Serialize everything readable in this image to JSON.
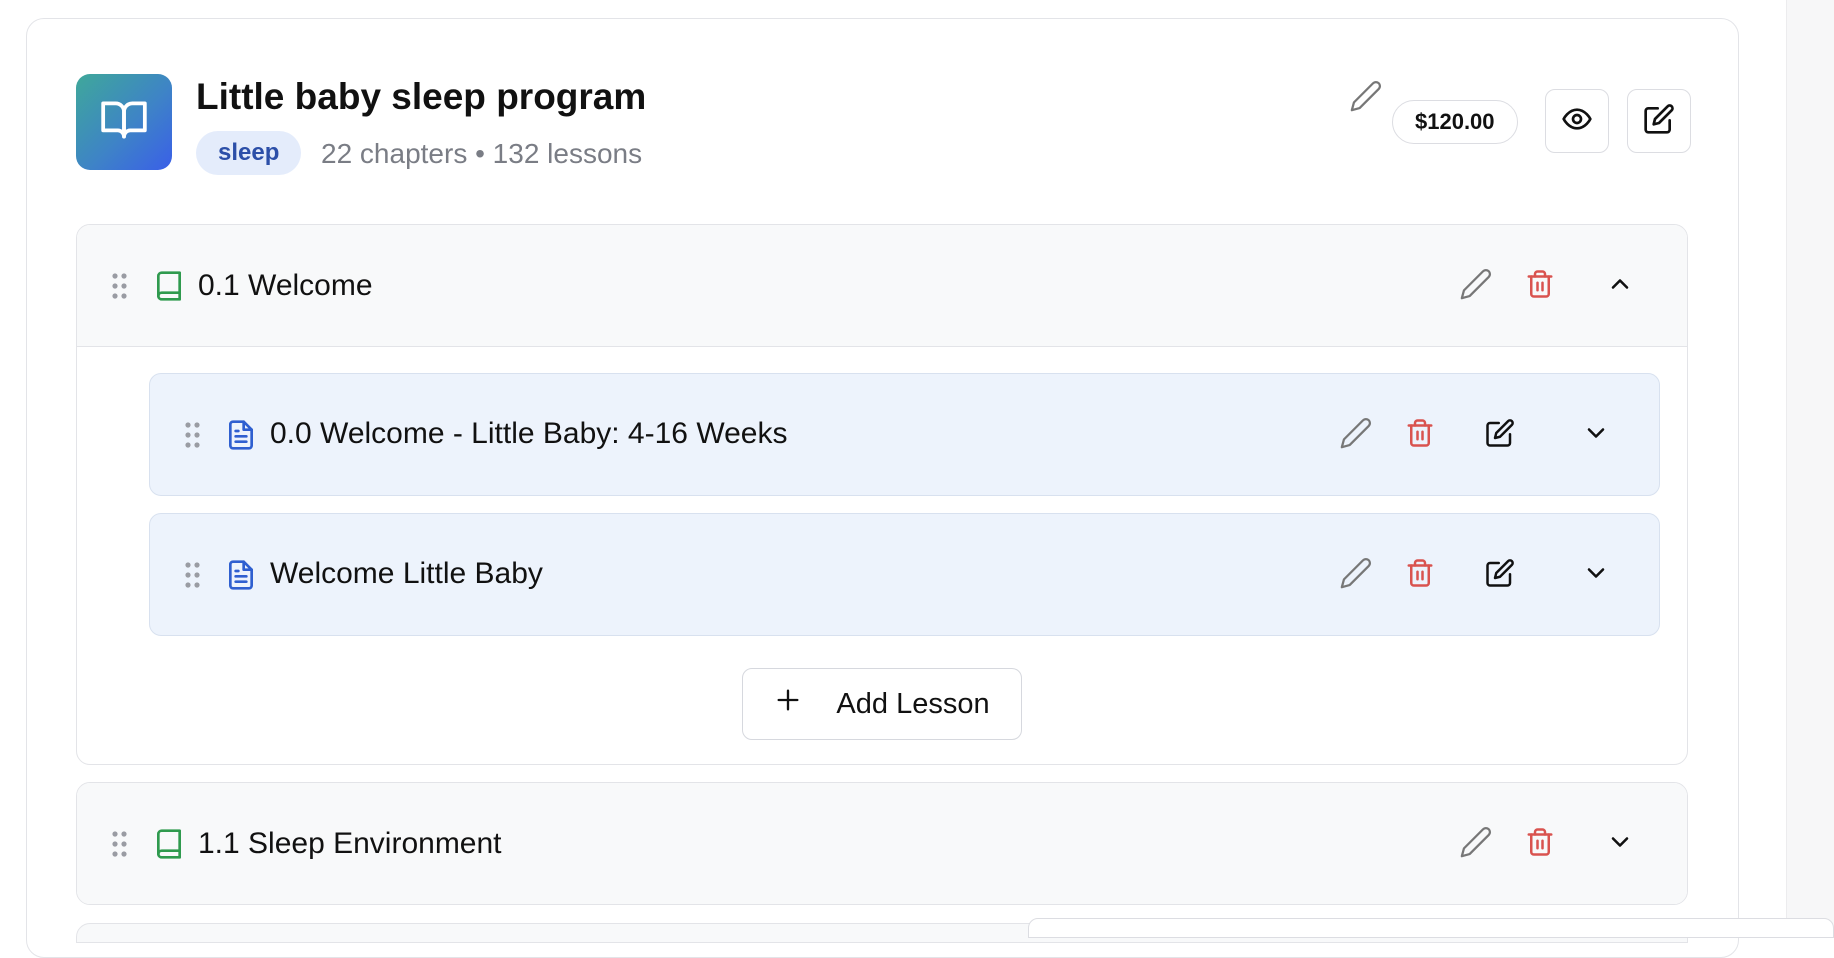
{
  "course": {
    "title": "Little baby sleep program",
    "tag": "sleep",
    "meta": "22 chapters • 132 lessons",
    "price": "$120.00",
    "icon": "open-book-icon",
    "colors": {
      "logo_gradient_start": "#3fa89a",
      "logo_gradient_end": "#3a5fe8",
      "tag_bg": "#e4ecfb",
      "tag_text": "#2c4fa8"
    }
  },
  "chapters": [
    {
      "title": "0.1 Welcome",
      "expanded": true,
      "lessons": [
        {
          "title": "0.0 Welcome - Little Baby: 4-16 Weeks"
        },
        {
          "title": "Welcome Little Baby"
        }
      ],
      "add_lesson_label": "Add Lesson"
    },
    {
      "title": "1.1 Sleep Environment",
      "expanded": false
    }
  ],
  "colors": {
    "chapter_icon": "#2f9a4e",
    "lesson_icon": "#2f5fd0",
    "delete_icon": "#d9534f",
    "lesson_bg": "#edf3fc"
  }
}
